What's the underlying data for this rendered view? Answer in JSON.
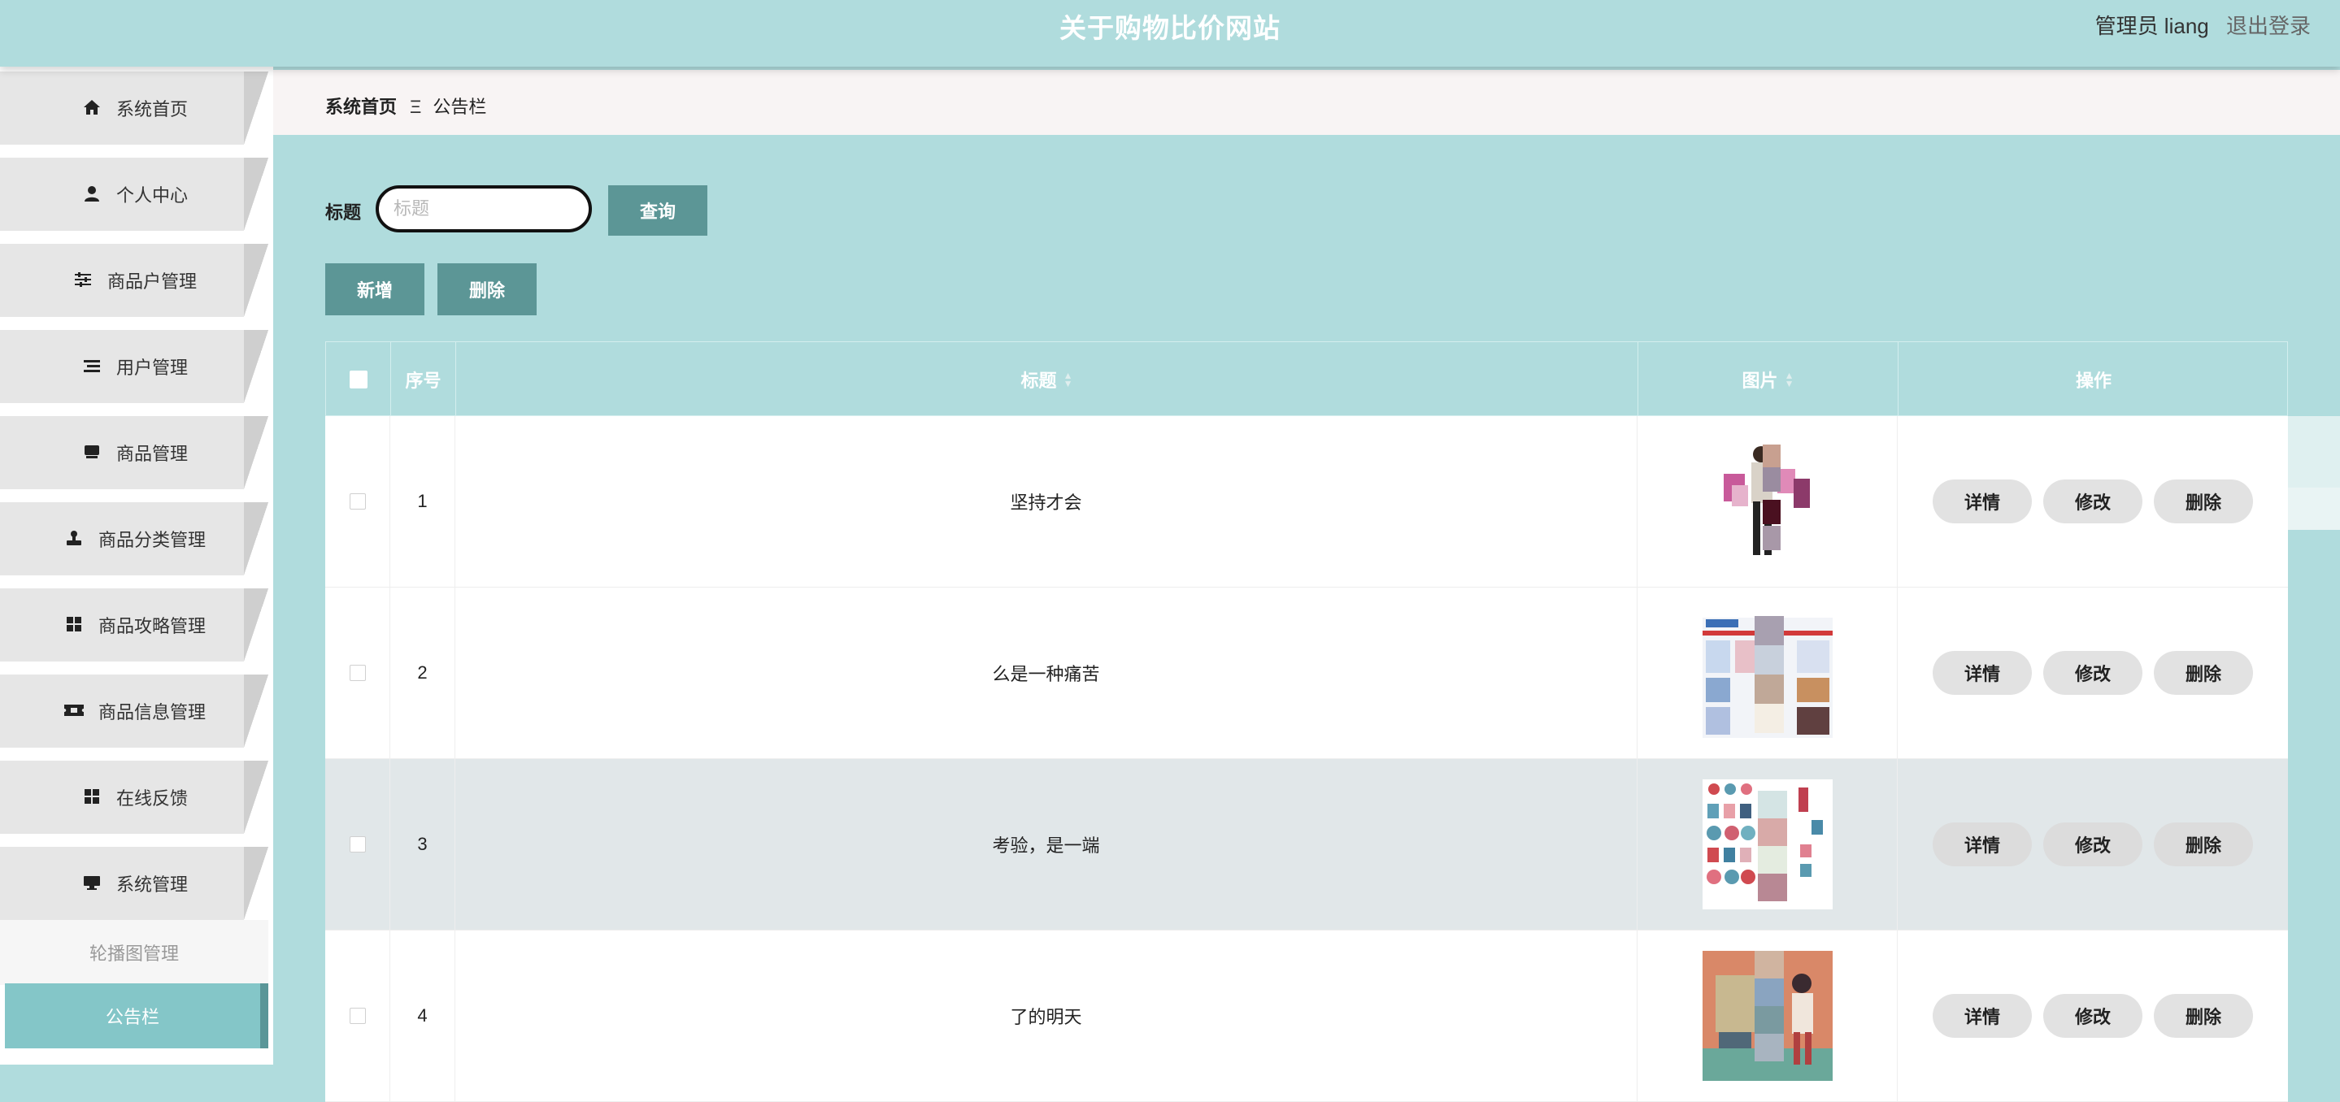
{
  "header": {
    "title": "关于购物比价网站",
    "user_label": "管理员 liang",
    "logout_label": "退出登录"
  },
  "sidebar": {
    "items": [
      {
        "label": "系统首页",
        "icon": "home-icon"
      },
      {
        "label": "个人中心",
        "icon": "user-icon"
      },
      {
        "label": "商品户管理",
        "icon": "sliders-icon"
      },
      {
        "label": "用户管理",
        "icon": "list-icon"
      },
      {
        "label": "商品管理",
        "icon": "box-icon"
      },
      {
        "label": "商品分类管理",
        "icon": "stamp-icon"
      },
      {
        "label": "商品攻略管理",
        "icon": "grid-icon"
      },
      {
        "label": "商品信息管理",
        "icon": "ticket-icon"
      },
      {
        "label": "在线反馈",
        "icon": "grid-icon"
      },
      {
        "label": "系统管理",
        "icon": "monitor-icon"
      }
    ],
    "sub_items": [
      {
        "label": "轮播图管理",
        "active": false
      },
      {
        "label": "公告栏",
        "active": true
      }
    ]
  },
  "breadcrumb": {
    "home": "系统首页",
    "separator": "Ξ",
    "current": "公告栏"
  },
  "search": {
    "label": "标题",
    "placeholder": "标题",
    "value": "",
    "button_label": "查询"
  },
  "toolbar": {
    "add_label": "新增",
    "delete_label": "删除"
  },
  "table": {
    "columns": [
      "序号",
      "标题",
      "图片",
      "操作"
    ],
    "rows": [
      {
        "index": "1",
        "title": "坚持才会",
        "image": "shopping-woman-image",
        "highlighted": false
      },
      {
        "index": "2",
        "title": "么是一种痛苦",
        "image": "ecommerce-page-image",
        "highlighted": false
      },
      {
        "index": "3",
        "title": "考验，是一端",
        "image": "product-icons-image",
        "highlighted": true
      },
      {
        "index": "4",
        "title": "了的明天",
        "image": "shopping-illustration-image",
        "highlighted": false
      }
    ],
    "actions": {
      "detail": "详情",
      "edit": "修改",
      "delete": "删除"
    }
  },
  "colors": {
    "header_bg": "#b0dcdd",
    "button_bg": "#5c9696",
    "active_sub_bg": "#84c6c8",
    "menu_bg": "#e6e6e6",
    "row_highlight": "#e1e7e9"
  }
}
